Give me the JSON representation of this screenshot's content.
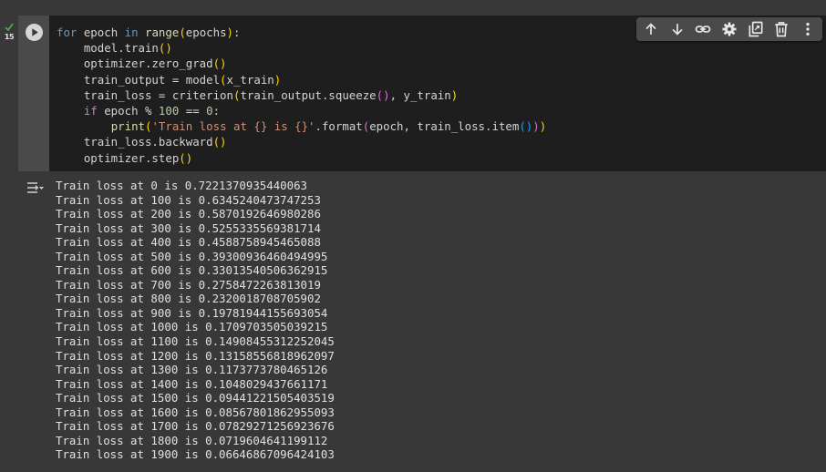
{
  "cell": {
    "execution_count": "15",
    "status": "completed"
  },
  "toolbar": {
    "buttons": [
      {
        "name": "move-cell-up",
        "icon": "arrow-up-icon"
      },
      {
        "name": "move-cell-down",
        "icon": "arrow-down-icon"
      },
      {
        "name": "copy-cell-link",
        "icon": "link-icon"
      },
      {
        "name": "cell-settings",
        "icon": "gear-icon"
      },
      {
        "name": "mirror-cell-in-tab",
        "icon": "mirror-cell-icon"
      },
      {
        "name": "delete-cell",
        "icon": "trash-icon"
      },
      {
        "name": "more-cell-actions",
        "icon": "more-vert-icon"
      }
    ]
  },
  "code": {
    "lines": [
      "for epoch in range(epochs):",
      "    model.train()",
      "    optimizer.zero_grad()",
      "    train_output = model(x_train)",
      "    train_loss = criterion(train_output.squeeze(), y_train)",
      "    if epoch % 100 == 0:",
      "        print('Train loss at {} is {}'.format(epoch, train_loss.item()))",
      "    train_loss.backward()",
      "    optimizer.step()"
    ]
  },
  "output": {
    "lines": [
      "Train loss at 0 is 0.7221370935440063",
      "Train loss at 100 is 0.6345240473747253",
      "Train loss at 200 is 0.5870192646980286",
      "Train loss at 300 is 0.5255335569381714",
      "Train loss at 400 is 0.4588758945465088",
      "Train loss at 500 is 0.39300936460494995",
      "Train loss at 600 is 0.33013540506362915",
      "Train loss at 700 is 0.2758472263813019",
      "Train loss at 800 is 0.2320018708705902",
      "Train loss at 900 is 0.19781944155693054",
      "Train loss at 1000 is 0.1709703505039215",
      "Train loss at 1100 is 0.14908455312252045",
      "Train loss at 1200 is 0.13158556818962097",
      "Train loss at 1300 is 0.1173773780465126",
      "Train loss at 1400 is 0.1048029437661171",
      "Train loss at 1500 is 0.09441221505403519",
      "Train loss at 1600 is 0.08567801862955093",
      "Train loss at 1700 is 0.07829271256923676",
      "Train loss at 1800 is 0.0719604641199112",
      "Train loss at 1900 is 0.06646867096424103"
    ]
  },
  "colors": {
    "background": "#383838",
    "code_background": "#1e1e1e",
    "keyword": "#569cd6",
    "control_keyword": "#c586c0",
    "builtin": "#dcdcaa",
    "number": "#b5cea8",
    "string": "#ce9178",
    "bracket_level_1": "#ffd700",
    "bracket_level_2": "#da70d6",
    "bracket_level_3": "#179fff",
    "success_check": "#4caf50"
  }
}
